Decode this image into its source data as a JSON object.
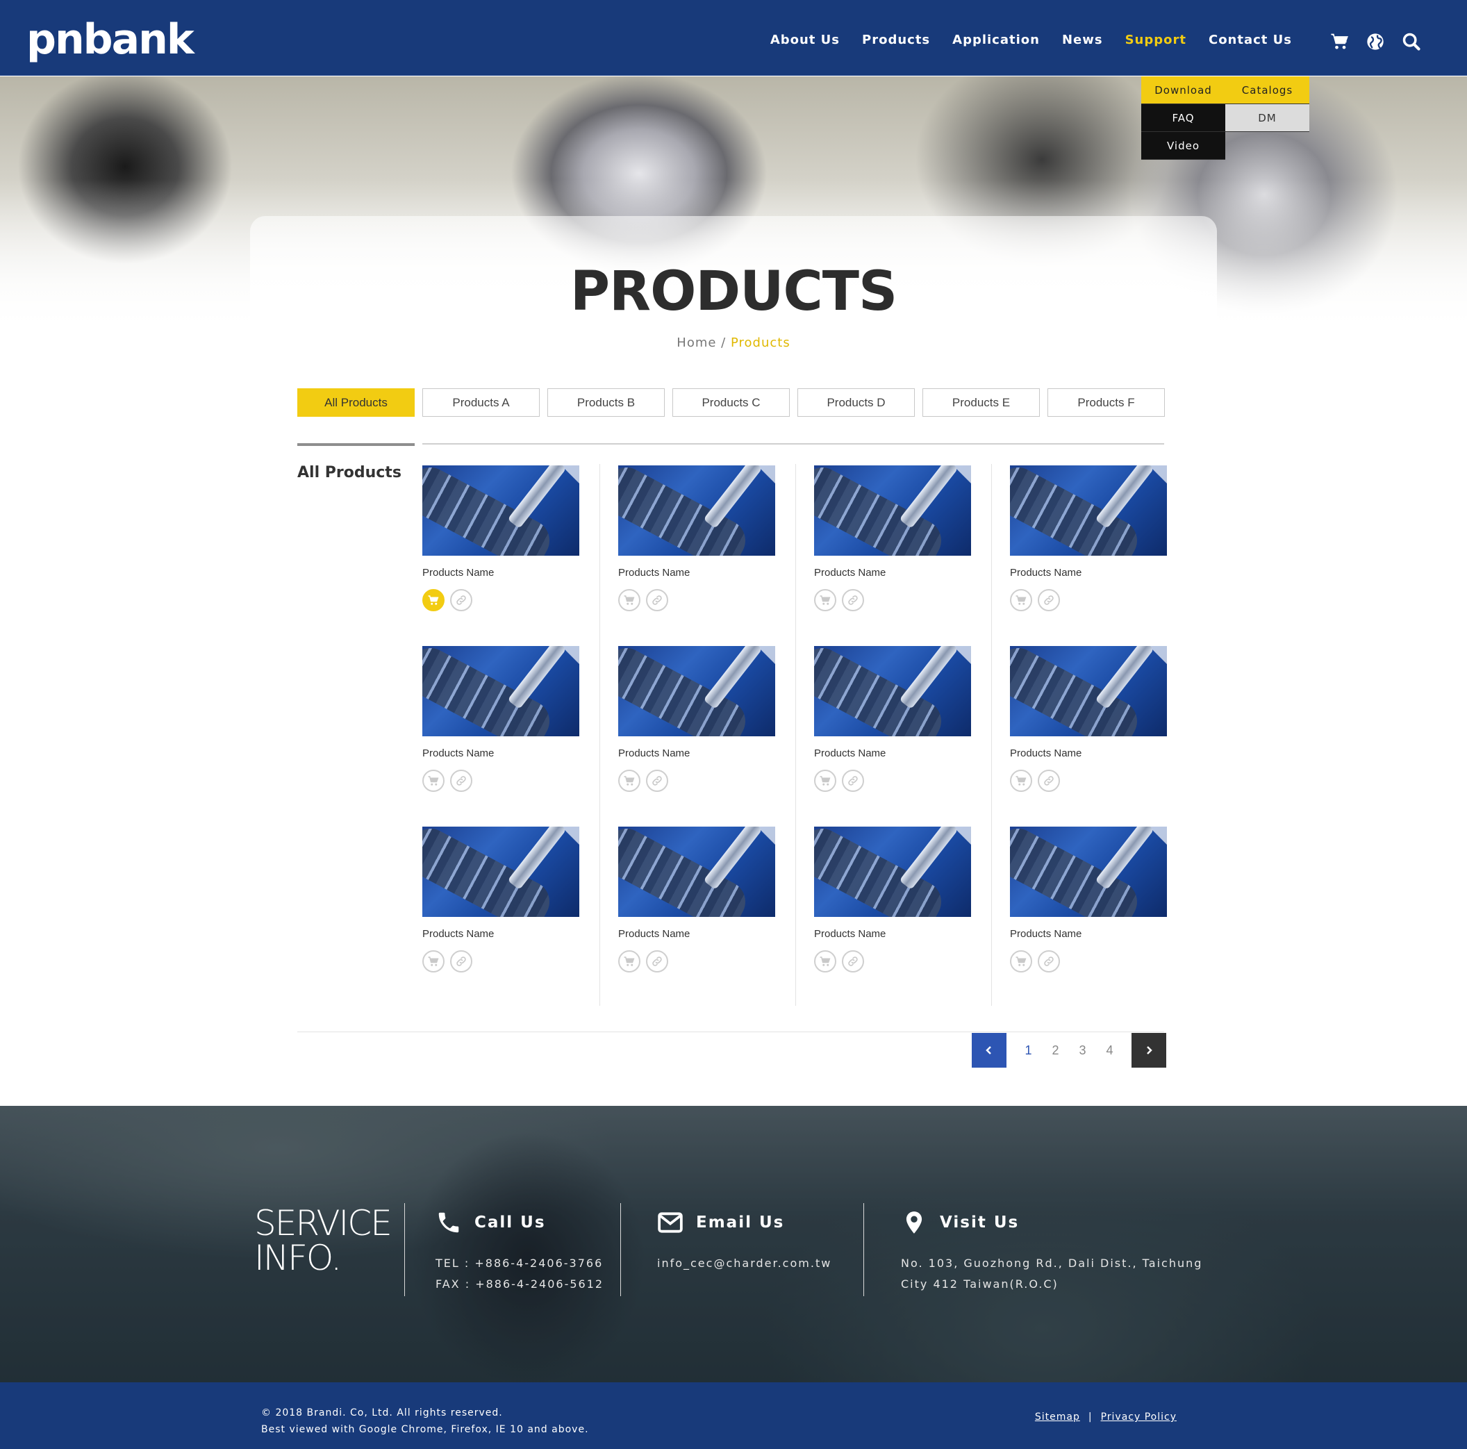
{
  "brand": {
    "logo_text": "pnbank",
    "logo_amp": "&"
  },
  "nav": {
    "items": [
      {
        "label": "About Us"
      },
      {
        "label": "Products"
      },
      {
        "label": "Application"
      },
      {
        "label": "News"
      },
      {
        "label": "Support",
        "active": true
      },
      {
        "label": "Contact Us"
      }
    ],
    "icons": [
      "cart-icon",
      "globe-icon",
      "search-icon"
    ]
  },
  "support_menu": {
    "download": "Download",
    "catalogs": "Catalogs",
    "faq": "FAQ",
    "dm": "DM",
    "video": "Video"
  },
  "hero": {
    "title": "PRODUCTS",
    "breadcrumb_home": "Home",
    "breadcrumb_sep": "/",
    "breadcrumb_current": "Products"
  },
  "tabs": [
    {
      "label": "All Products",
      "active": true
    },
    {
      "label": "Products A"
    },
    {
      "label": "Products B"
    },
    {
      "label": "Products C"
    },
    {
      "label": "Products D"
    },
    {
      "label": "Products E"
    },
    {
      "label": "Products F"
    }
  ],
  "section_label": "All Products",
  "products": [
    {
      "name": "Products Name",
      "cart_active": true
    },
    {
      "name": "Products Name"
    },
    {
      "name": "Products Name"
    },
    {
      "name": "Products Name"
    },
    {
      "name": "Products Name"
    },
    {
      "name": "Products Name"
    },
    {
      "name": "Products Name"
    },
    {
      "name": "Products Name"
    },
    {
      "name": "Products Name"
    },
    {
      "name": "Products Name"
    },
    {
      "name": "Products Name"
    },
    {
      "name": "Products Name"
    }
  ],
  "pagination": {
    "pages": [
      "1",
      "2",
      "3",
      "4"
    ],
    "current": "1"
  },
  "service": {
    "title_line1": "SERVICE",
    "title_line2": "INFO.",
    "call": {
      "heading": "Call Us",
      "tel": "TEL : +886-4-2406-3766",
      "fax": "FAX : +886-4-2406-5612"
    },
    "email": {
      "heading": "Email Us",
      "address": "info_cec@charder.com.tw"
    },
    "visit": {
      "heading": "Visit Us",
      "line1": "No. 103, Guozhong Rd., Dali Dist., Taichung",
      "line2": "City 412 Taiwan(R.O.C)"
    }
  },
  "footer": {
    "copyright": "© 2018 Brandi. Co, Ltd. All rights reserved.",
    "browsers": "Best viewed with Google Chrome, Firefox, IE 10 and above.",
    "sitemap": "Sitemap",
    "sep": "|",
    "privacy": "Privacy Policy"
  },
  "colors": {
    "navy": "#183a7a",
    "yellow": "#f2cc12",
    "pager_blue": "#2d55b3"
  }
}
